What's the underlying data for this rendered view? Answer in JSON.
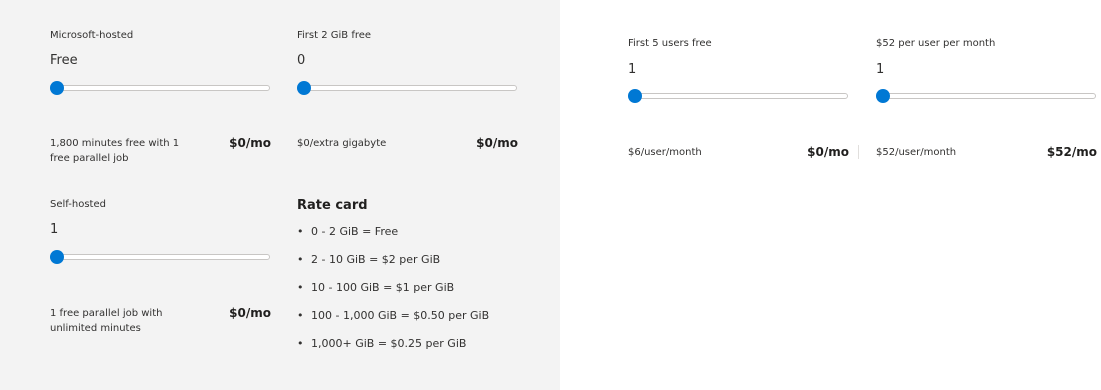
{
  "pipelines": {
    "microsoft_hosted": {
      "caption": "Microsoft-hosted",
      "value": "Free",
      "slider_fraction": 0,
      "description": "1,800 minutes free with 1 free parallel job",
      "price": "$0/mo"
    },
    "self_hosted": {
      "caption": "Self-hosted",
      "value": "1",
      "slider_fraction": 0,
      "description": "1 free parallel job with unlimited minutes",
      "price": "$0/mo"
    }
  },
  "artifacts": {
    "caption": "First 2 GiB free",
    "value": "0",
    "slider_fraction": 0,
    "description": "$0/extra gigabyte",
    "price": "$0/mo",
    "rate_card": {
      "title": "Rate card",
      "items": [
        "0 - 2 GiB = Free",
        "2 - 10 GiB = $2 per GiB",
        "10 - 100 GiB = $1 per GiB",
        "100 - 1,000 GiB = $0.50 per GiB",
        "1,000+ GiB = $0.25 per GiB"
      ]
    }
  },
  "basic_users": {
    "caption": "First 5 users free",
    "value": "1",
    "slider_fraction": 0,
    "description": "$6/user/month",
    "price": "$0/mo"
  },
  "test_plans_users": {
    "caption": "$52 per user per month",
    "value": "1",
    "slider_fraction": 0,
    "description": "$52/user/month",
    "price": "$52/mo"
  },
  "colors": {
    "accent": "#0078d4",
    "panel_bg": "#f3f3f3"
  }
}
